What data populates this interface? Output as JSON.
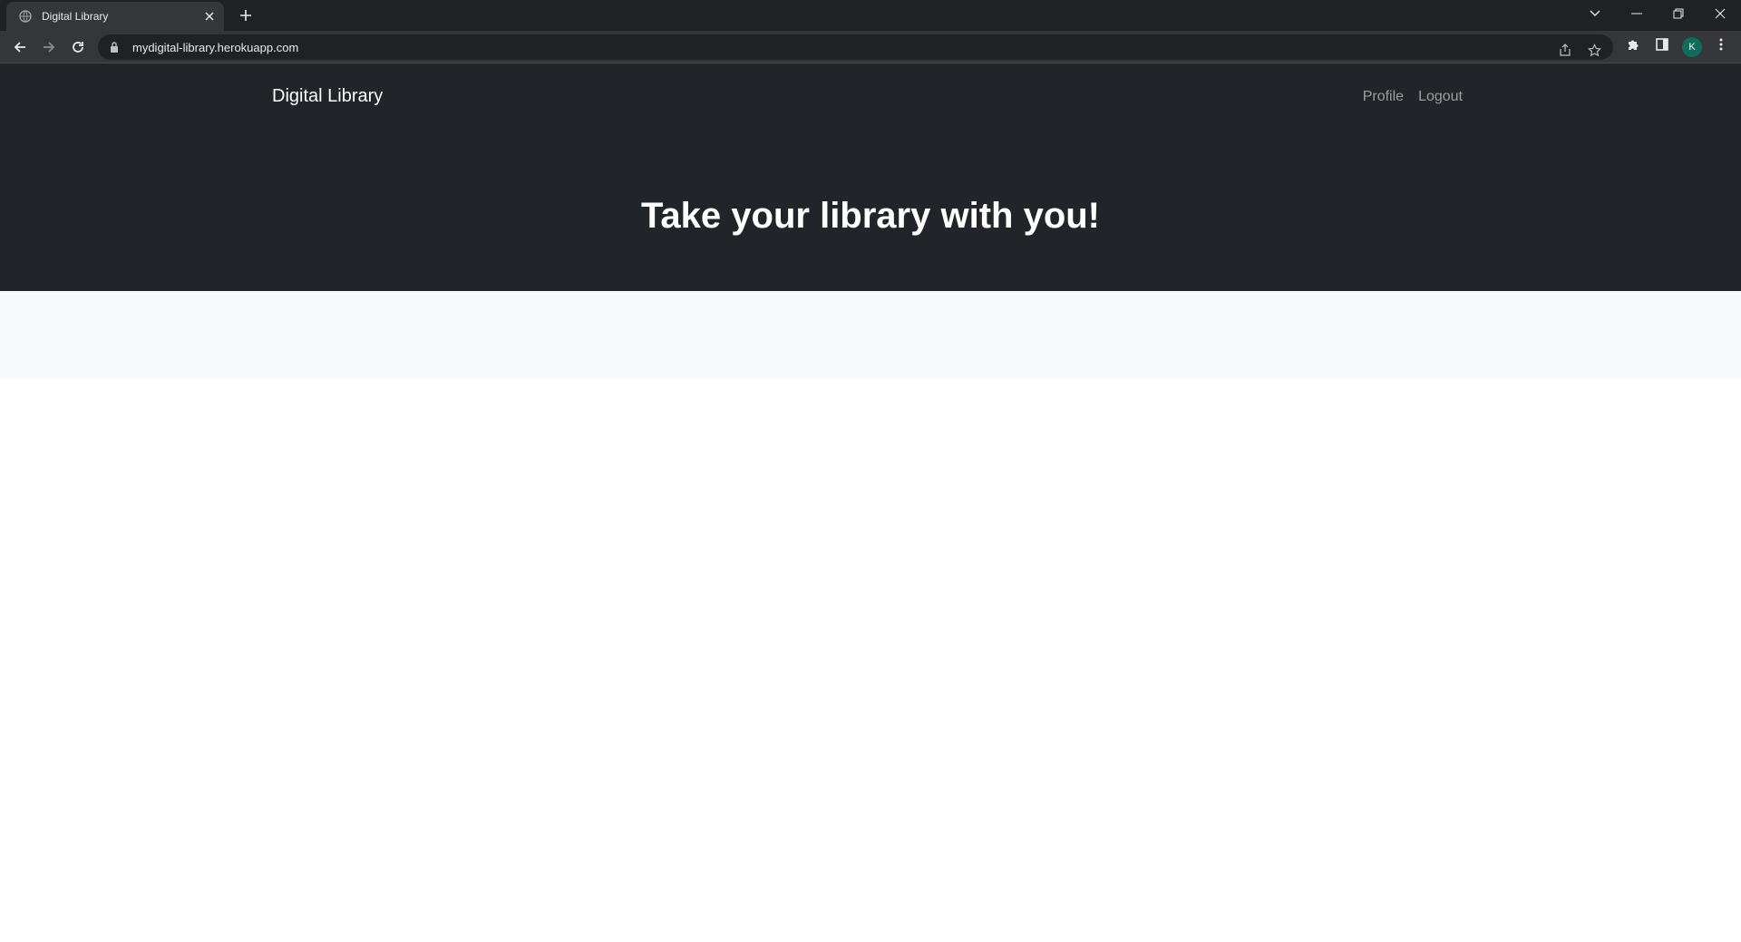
{
  "browser": {
    "tab_title": "Digital Library",
    "url": "mydigital-library.herokuapp.com",
    "profile_initial": "K"
  },
  "site": {
    "brand": "Digital Library",
    "nav": [
      "Profile",
      "Logout"
    ],
    "hero_title": "Take your library with you!"
  },
  "colors": {
    "hero_bg": "#212529",
    "band_bg": "#f8f9fa",
    "avatar_bg": "#0d6e5b"
  }
}
